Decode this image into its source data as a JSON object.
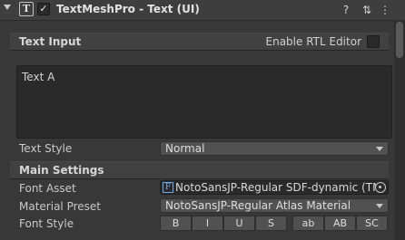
{
  "component": {
    "title": "TextMeshPro - Text (UI)",
    "icon": "text-component-icon",
    "enabled": true,
    "enabled_mark": "✓",
    "icon_glyph": "T",
    "header_icons": [
      "help-icon",
      "presets-icon",
      "more-icon"
    ],
    "help_glyph": "?",
    "presets_glyph": "⇅",
    "more_glyph": "⋮"
  },
  "text_input": {
    "section_label": "Text Input",
    "rtl_label": "Enable RTL Editor",
    "rtl_checked": false,
    "value": "Text A"
  },
  "text_style": {
    "label": "Text Style",
    "value": "Normal"
  },
  "main_settings": {
    "section_label": "Main Settings",
    "font_asset_label": "Font Asset",
    "font_asset_value": "NotoSansJP-Regular SDF-dynamic (TM",
    "font_asset_icon_glyph": "F",
    "material_preset_label": "Material Preset",
    "material_preset_value": "NotoSansJP-Regular Atlas Material",
    "font_style_label": "Font Style",
    "font_style_buttons": [
      "B",
      "I",
      "U",
      "S",
      "ab",
      "AB",
      "SC"
    ]
  },
  "colors": {
    "background": "#383838",
    "field": "#2a2a2a",
    "accent_icon": "#6aa7ea"
  }
}
